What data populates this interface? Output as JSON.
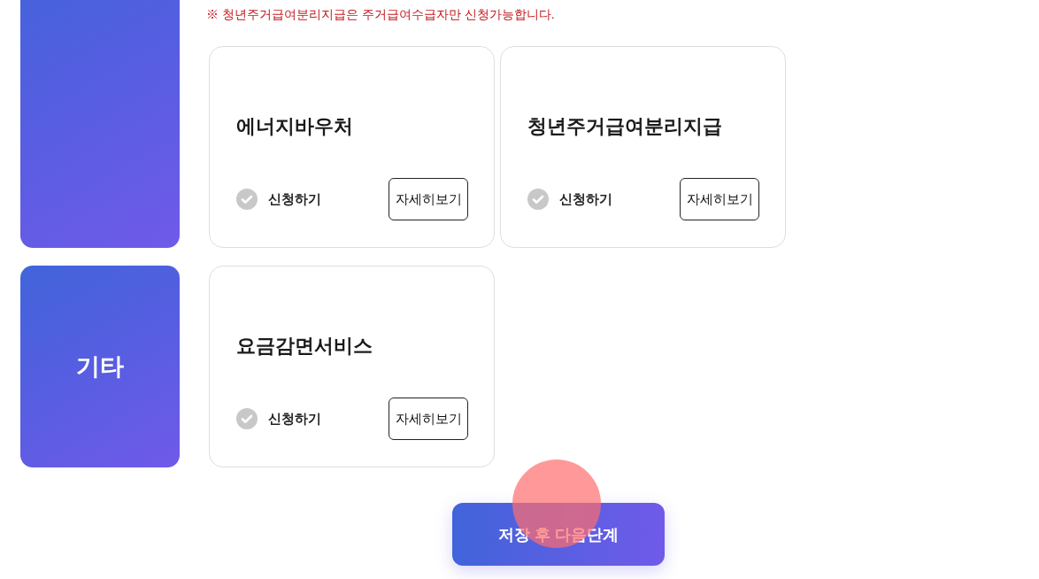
{
  "notice": "※ 청년주거급여분리지급은 주거급여수급자만 신청가능합니다.",
  "sections": [
    {
      "services": [
        {
          "name": "에너지바우처",
          "apply": {
            "label": "신청하기",
            "checked": false
          },
          "details_button": "자세히보기"
        },
        {
          "name": "청년주거급여분리지급",
          "apply": {
            "label": "신청하기",
            "checked": false
          },
          "details_button": "자세히보기"
        }
      ]
    },
    {
      "label": "기타",
      "services": [
        {
          "name": "요금감면서비스",
          "apply": {
            "label": "신청하기",
            "checked": false
          },
          "details_button": "자세히보기"
        }
      ]
    }
  ],
  "next_button": {
    "label": "저장 후 다음단계",
    "tap_indicator": true
  }
}
